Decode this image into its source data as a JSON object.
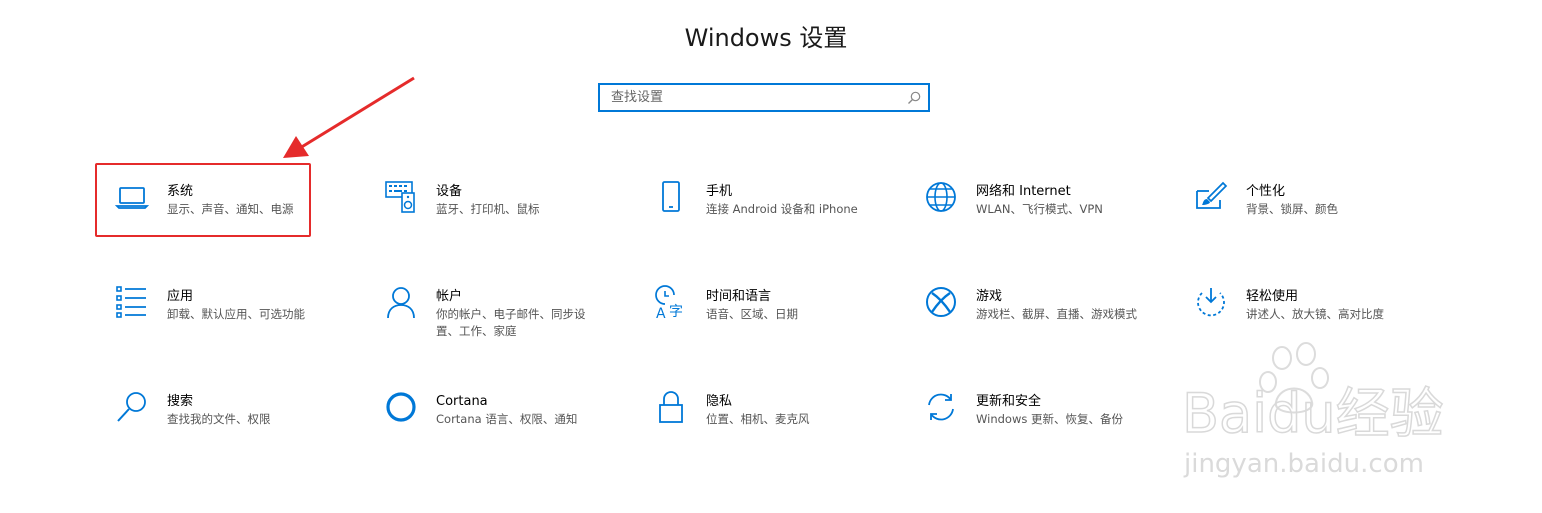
{
  "header": {
    "title": "Windows 设置"
  },
  "search": {
    "placeholder": "查找设置"
  },
  "accent_color": "#0078d7",
  "highlight_color": "#e52b2b",
  "tiles": [
    {
      "name": "系统",
      "desc": "显示、声音、通知、电源",
      "icon": "laptop-icon"
    },
    {
      "name": "设备",
      "desc": "蓝牙、打印机、鼠标",
      "icon": "keyboard-speaker-icon"
    },
    {
      "name": "手机",
      "desc": "连接 Android 设备和 iPhone",
      "icon": "phone-icon"
    },
    {
      "name": "网络和 Internet",
      "desc": "WLAN、飞行模式、VPN",
      "icon": "globe-icon"
    },
    {
      "name": "个性化",
      "desc": "背景、锁屏、颜色",
      "icon": "paintbrush-icon"
    },
    {
      "name": "应用",
      "desc": "卸载、默认应用、可选功能",
      "icon": "apps-list-icon"
    },
    {
      "name": "帐户",
      "desc": "你的帐户、电子邮件、同步设置、工作、家庭",
      "icon": "person-icon"
    },
    {
      "name": "时间和语言",
      "desc": "语音、区域、日期",
      "icon": "time-language-icon"
    },
    {
      "name": "游戏",
      "desc": "游戏栏、截屏、直播、游戏模式",
      "icon": "xbox-icon"
    },
    {
      "name": "轻松使用",
      "desc": "讲述人、放大镜、高对比度",
      "icon": "ease-of-access-icon"
    },
    {
      "name": "搜索",
      "desc": "查找我的文件、权限",
      "icon": "search-magnifier-icon"
    },
    {
      "name": "Cortana",
      "desc": "Cortana 语言、权限、通知",
      "icon": "cortana-ring-icon"
    },
    {
      "name": "隐私",
      "desc": "位置、相机、麦克风",
      "icon": "lock-icon"
    },
    {
      "name": "更新和安全",
      "desc": "Windows 更新、恢复、备份",
      "icon": "sync-icon"
    }
  ],
  "watermark": {
    "logo": "Baidu经验",
    "url": "jingyan.baidu.com"
  }
}
